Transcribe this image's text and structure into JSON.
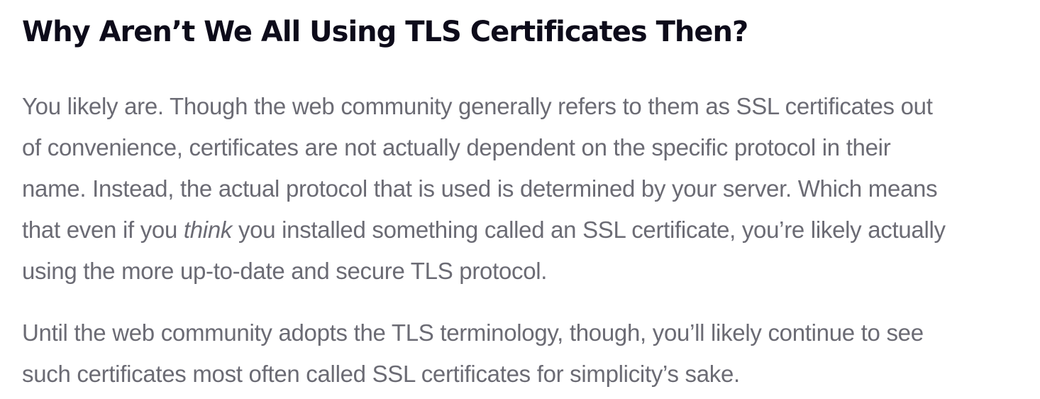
{
  "article": {
    "heading": "Why Aren’t We All Using TLS Certificates Then?",
    "paragraph1": {
      "line1": "You likely are. Though the web community generally refers to them as SSL certificates out",
      "line2": "of convenience, certificates are not actually dependent on the specific protocol in their",
      "line3": "name. Instead, the actual protocol that is used is determined by your server. Which means",
      "line4_before": "that even if you ",
      "line4_emphasis": "think",
      "line4_after": " you installed something called an SSL certificate, you’re likely actually",
      "line5": "using the more up-to-date and secure TLS protocol."
    },
    "paragraph2": {
      "line1": "Until the web community adopts the TLS terminology, though, you’ll likely continue to see",
      "line2": "such certificates most often called SSL certificates for simplicity’s sake."
    }
  }
}
